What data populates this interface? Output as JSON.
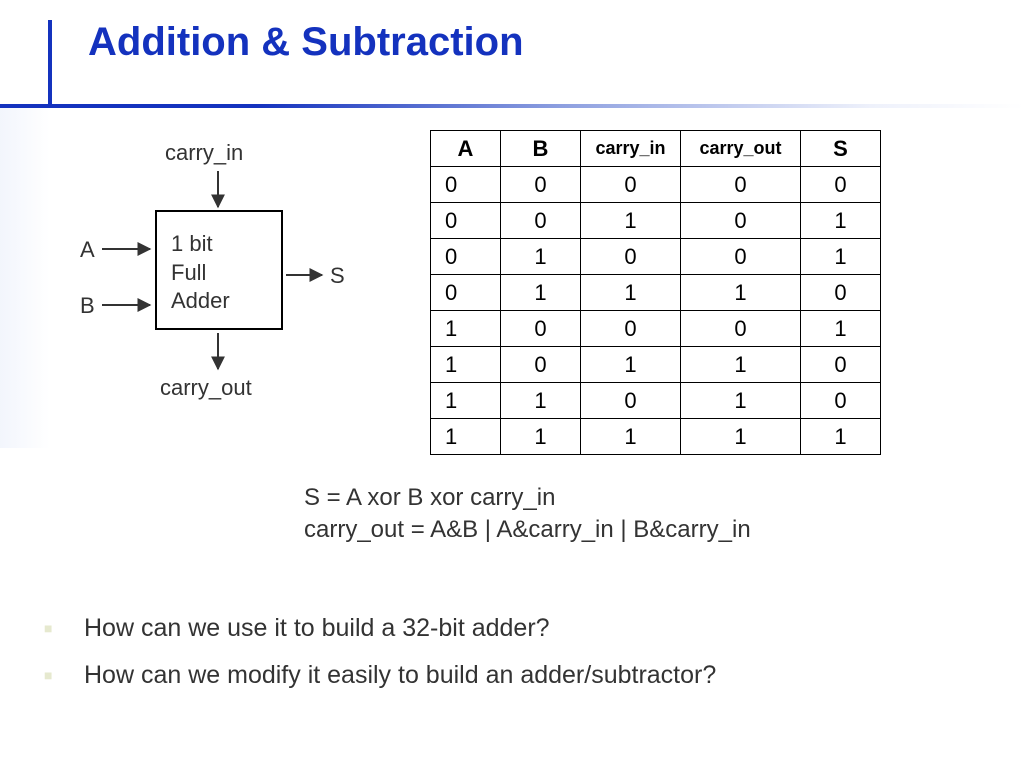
{
  "title": "Addition & Subtraction",
  "diagram": {
    "carry_in": "carry_in",
    "carry_out": "carry_out",
    "A": "A",
    "B": "B",
    "S": "S",
    "box_l1": "1 bit",
    "box_l2": "Full",
    "box_l3": "Adder"
  },
  "table": {
    "headers": {
      "A": "A",
      "B": "B",
      "cin": "carry_in",
      "cout": "carry_out",
      "S": "S"
    },
    "rows": [
      {
        "A": "0",
        "B": "0",
        "cin": "0",
        "cout": "0",
        "S": "0"
      },
      {
        "A": "0",
        "B": "0",
        "cin": "1",
        "cout": "0",
        "S": "1"
      },
      {
        "A": "0",
        "B": "1",
        "cin": "0",
        "cout": "0",
        "S": "1"
      },
      {
        "A": "0",
        "B": "1",
        "cin": "1",
        "cout": "1",
        "S": "0"
      },
      {
        "A": "1",
        "B": "0",
        "cin": "0",
        "cout": "0",
        "S": "1"
      },
      {
        "A": "1",
        "B": "0",
        "cin": "1",
        "cout": "1",
        "S": "0"
      },
      {
        "A": "1",
        "B": "1",
        "cin": "0",
        "cout": "1",
        "S": "0"
      },
      {
        "A": "1",
        "B": "1",
        "cin": "1",
        "cout": "1",
        "S": "1"
      }
    ]
  },
  "eq": {
    "s": "S = A  xor  B  xor  carry_in",
    "co": "carry_out  = A&B  |  A&carry_in  |  B&carry_in"
  },
  "bullets": {
    "q1": "How can we use it to build a 32-bit adder?",
    "q2": "How can we modify it easily to build an adder/subtractor?"
  }
}
